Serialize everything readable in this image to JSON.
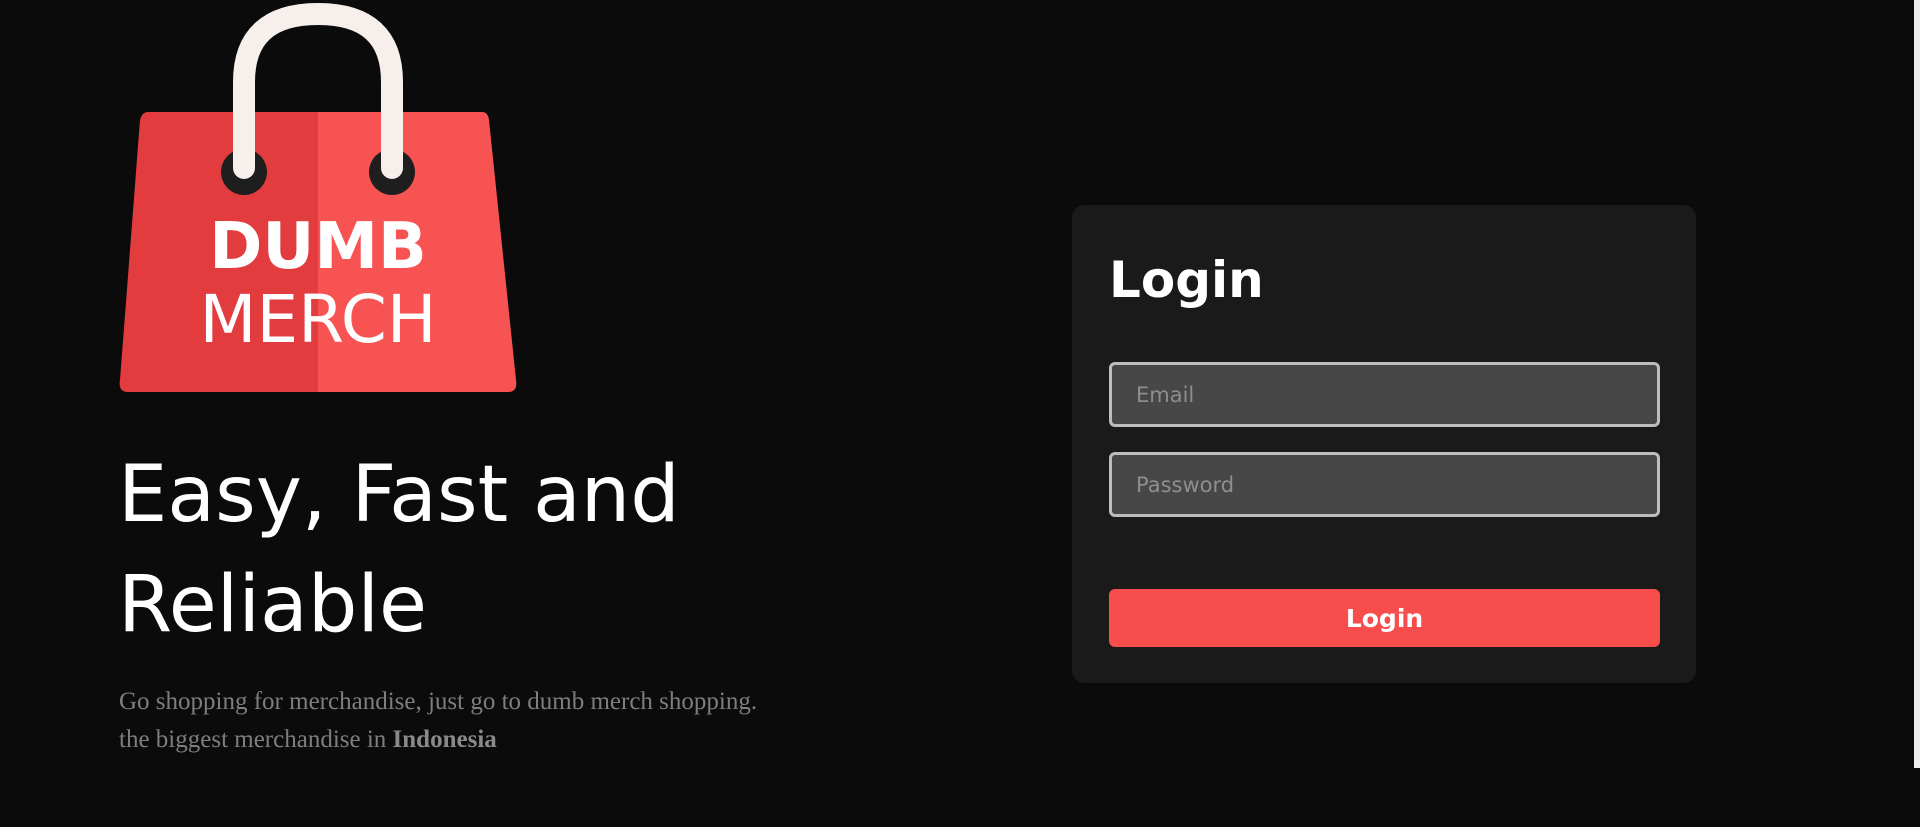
{
  "brand": {
    "logo_line1": "DUMB",
    "logo_line2": "MERCH",
    "bag_color_light": "#f85353",
    "bag_color_dark": "#e23c3f",
    "handle_color": "#f7efec",
    "icon": "shopping-bag-icon"
  },
  "hero": {
    "title": "Easy, Fast and Reliable",
    "description": "Go shopping for merchandise, just go to dumb merch shopping. the biggest merchandise in ",
    "description_emphasis": "Indonesia"
  },
  "login": {
    "title": "Login",
    "email_placeholder": "Email",
    "password_placeholder": "Password",
    "submit_label": "Login",
    "accent": "#f74d4d"
  }
}
